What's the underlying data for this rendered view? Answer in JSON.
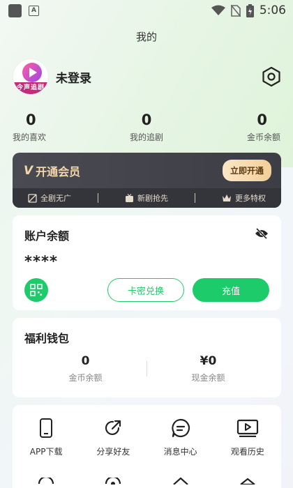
{
  "status_bar": {
    "time": "5:06"
  },
  "header": {
    "title": "我的"
  },
  "profile": {
    "username": "未登录",
    "avatar_text": "今声追剧"
  },
  "stats": [
    {
      "value": "0",
      "label": "我的喜欢"
    },
    {
      "value": "0",
      "label": "我的追剧"
    },
    {
      "value": "0",
      "label": "金币余额"
    }
  ],
  "vip": {
    "title": "开通会员",
    "cta": "立即开通",
    "perks": [
      "全剧无广",
      "新剧抢先",
      "更多特权"
    ]
  },
  "balance": {
    "title": "账户余额",
    "masked_value": "****",
    "redeem_label": "卡密兑换",
    "recharge_label": "充值"
  },
  "wallet": {
    "title": "福利钱包",
    "coins_value": "0",
    "coins_label": "金币余额",
    "cash_value": "¥0",
    "cash_label": "现金余额"
  },
  "tools": [
    {
      "label": "APP下载",
      "icon": "phone-icon"
    },
    {
      "label": "分享好友",
      "icon": "share-icon"
    },
    {
      "label": "消息中心",
      "icon": "message-icon"
    },
    {
      "label": "观看历史",
      "icon": "history-icon"
    }
  ],
  "colors": {
    "accent": "#1ecb6a",
    "vip_gold": "#f3d7a8",
    "vip_bg": "#44444c"
  }
}
